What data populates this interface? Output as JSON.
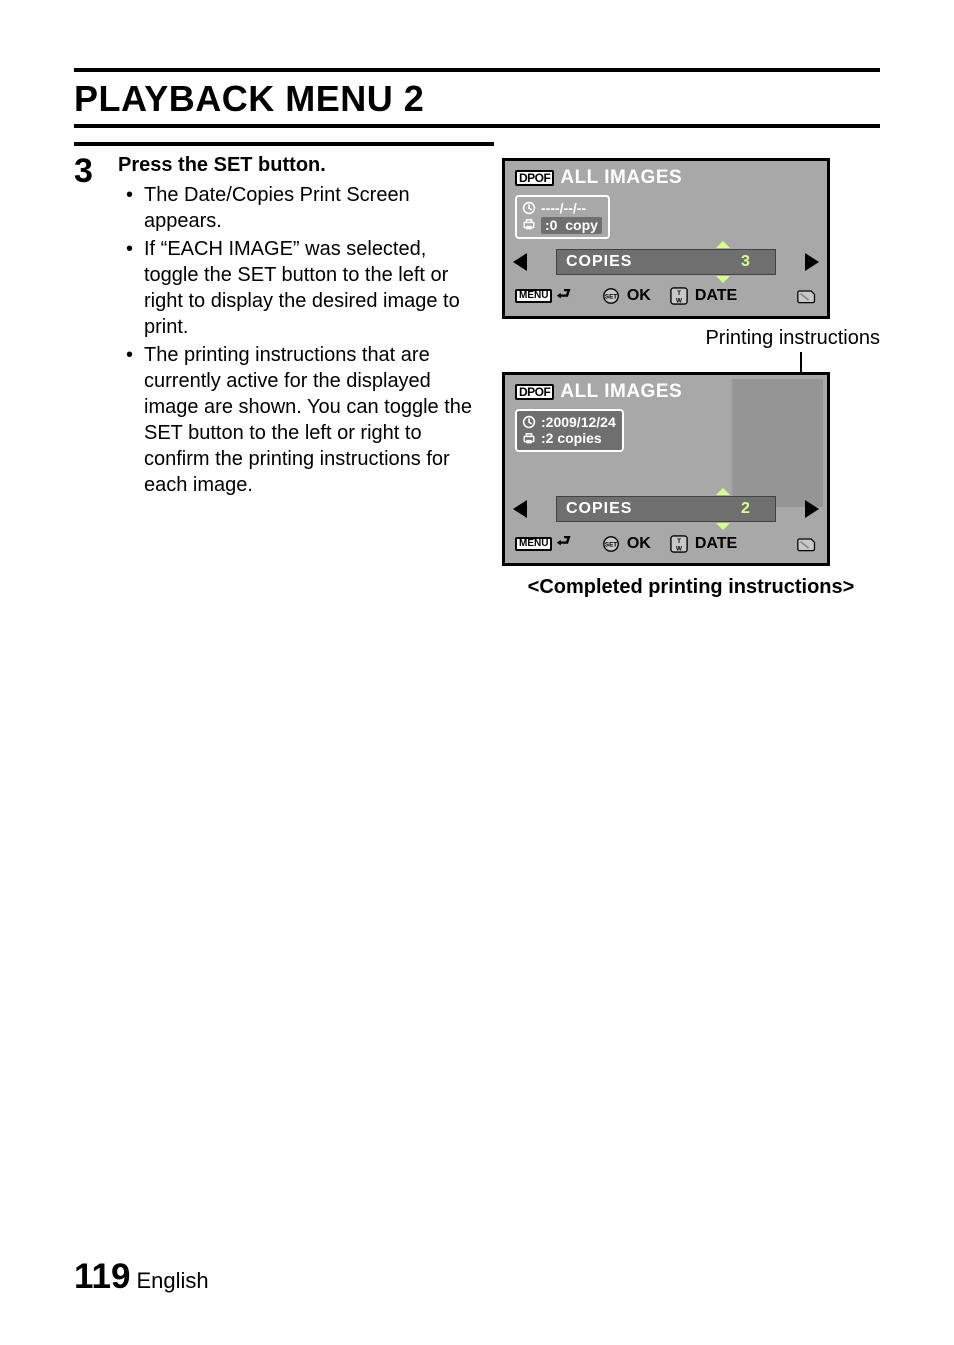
{
  "title": "PLAYBACK MENU 2",
  "step": {
    "number": "3",
    "heading": "Press the SET button.",
    "bullets": [
      "The Date/Copies Print Screen appears.",
      "If “EACH IMAGE” was selected, toggle the SET button to the left or right to display the desired image to print.",
      "The printing instructions that are currently active for the displayed image are shown. You can toggle the SET button to the left or right to confirm the printing instructions for each image."
    ]
  },
  "screen1": {
    "dpof": "DPOF",
    "title": "ALL IMAGES",
    "date": "----/--/--",
    "copies_info": ":0  copy",
    "copies_label": "COPIES",
    "copies_value": "3",
    "menu": "MENU",
    "ok": "OK",
    "date_btn": "DATE"
  },
  "annot": "Printing instructions",
  "screen2": {
    "dpof": "DPOF",
    "title": "ALL IMAGES",
    "date": ":2009/12/24",
    "copies_info": ":2 copies",
    "copies_label": "COPIES",
    "copies_value": "2",
    "menu": "MENU",
    "ok": "OK",
    "date_btn": "DATE"
  },
  "caption_completed": "<Completed printing instructions>",
  "footer": {
    "page": "119",
    "lang": "English"
  }
}
